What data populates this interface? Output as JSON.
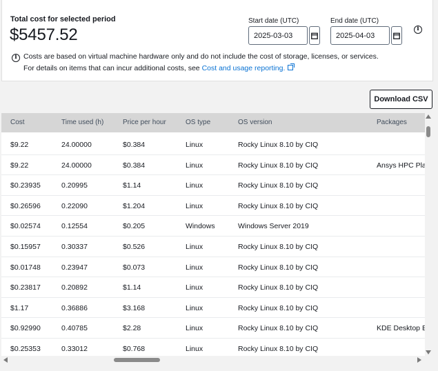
{
  "summary": {
    "total_label": "Total cost for selected period",
    "total_value": "$5457.52",
    "start_label": "Start date (UTC)",
    "start_value": "2025-03-03",
    "end_label": "End date (UTC)",
    "end_value": "2025-04-03",
    "note_line1": "Costs are based on virtual machine hardware only and do not include the cost of storage, licenses, or services.",
    "note_line2_prefix": "For details on items that can incur additional costs, see",
    "note_link": "Cost and usage reporting."
  },
  "toolbar": {
    "download_label": "Download CSV"
  },
  "table": {
    "columns": [
      "Cost",
      "Time used (h)",
      "Price per hour",
      "OS type",
      "OS version",
      "Packages"
    ],
    "rows": [
      [
        "$9.22",
        "24.00000",
        "$0.384",
        "Linux",
        "Rocky Linux 8.10 by CIQ",
        ""
      ],
      [
        "$9.22",
        "24.00000",
        "$0.384",
        "Linux",
        "Rocky Linux 8.10 by CIQ",
        "Ansys HPC Plat"
      ],
      [
        "$0.23935",
        "0.20995",
        "$1.14",
        "Linux",
        "Rocky Linux 8.10 by CIQ",
        ""
      ],
      [
        "$0.26596",
        "0.22090",
        "$1.204",
        "Linux",
        "Rocky Linux 8.10 by CIQ",
        ""
      ],
      [
        "$0.02574",
        "0.12554",
        "$0.205",
        "Windows",
        "Windows Server 2019",
        ""
      ],
      [
        "$0.15957",
        "0.30337",
        "$0.526",
        "Linux",
        "Rocky Linux 8.10 by CIQ",
        ""
      ],
      [
        "$0.01748",
        "0.23947",
        "$0.073",
        "Linux",
        "Rocky Linux 8.10 by CIQ",
        ""
      ],
      [
        "$0.23817",
        "0.20892",
        "$1.14",
        "Linux",
        "Rocky Linux 8.10 by CIQ",
        ""
      ],
      [
        "$1.17",
        "0.36886",
        "$3.168",
        "Linux",
        "Rocky Linux 8.10 by CIQ",
        ""
      ],
      [
        "$0.92990",
        "0.40785",
        "$2.28",
        "Linux",
        "Rocky Linux 8.10 by CIQ",
        "KDE Desktop E"
      ],
      [
        "$0.25353",
        "0.33012",
        "$0.768",
        "Linux",
        "Rocky Linux 8.10 by CIQ",
        ""
      ]
    ]
  },
  "colors": {
    "link": "#0972d3",
    "header_bg": "#d6d6d6",
    "text": "#16191f"
  },
  "icons": [
    "info-icon",
    "calendar-icon",
    "external-link-icon"
  ]
}
